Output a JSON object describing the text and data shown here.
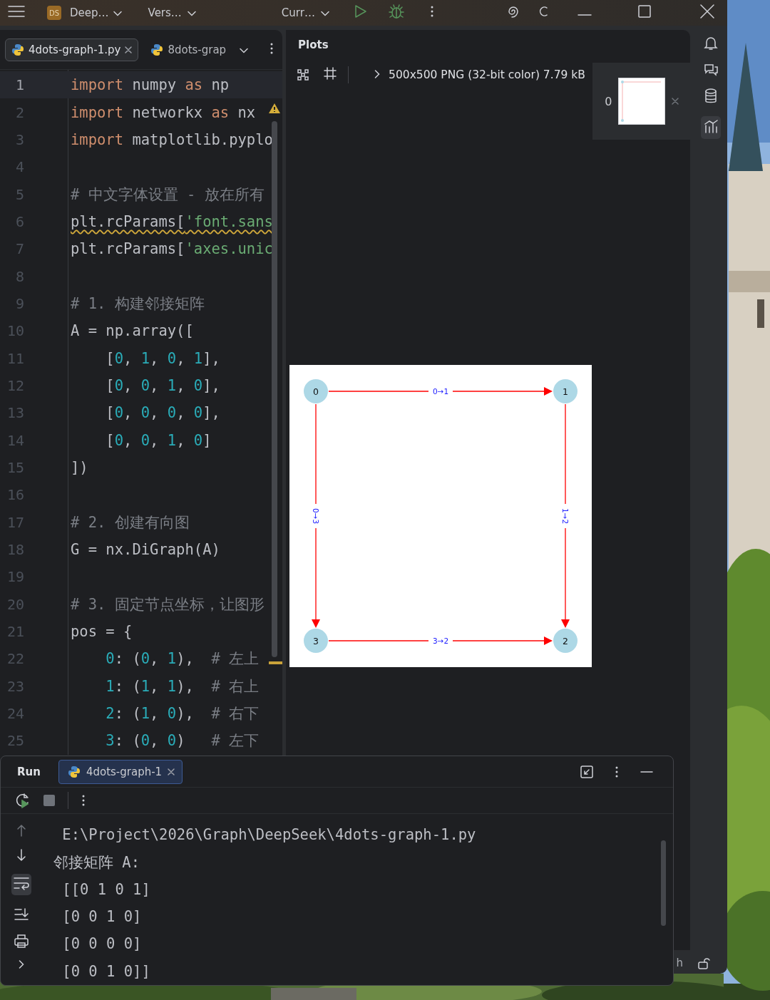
{
  "title_bar": {
    "project_badge": "DS",
    "project": "Deep…",
    "vcs": "Vers…",
    "run_config": "Curr…"
  },
  "editor": {
    "tabs": [
      {
        "label": "4dots-graph-1.py",
        "selected": true
      },
      {
        "label": "8dots-grap",
        "selected": false
      }
    ],
    "lines": [
      {
        "number": "1",
        "current": true,
        "tokens": [
          {
            "kind": "kw",
            "text": "import"
          },
          {
            "kind": "plain",
            "text": " numpy "
          },
          {
            "kind": "kw",
            "text": "as"
          },
          {
            "kind": "plain",
            "text": " np"
          }
        ]
      },
      {
        "number": "2",
        "current": false,
        "tokens": [
          {
            "kind": "kw",
            "text": "import"
          },
          {
            "kind": "plain",
            "text": " networkx "
          },
          {
            "kind": "kw",
            "text": "as"
          },
          {
            "kind": "plain",
            "text": " nx"
          }
        ]
      },
      {
        "number": "3",
        "current": false,
        "tokens": [
          {
            "kind": "kw",
            "text": "import"
          },
          {
            "kind": "plain",
            "text": " matplotlib.pyplo"
          }
        ]
      },
      {
        "number": "4",
        "current": false
      },
      {
        "number": "5",
        "current": false,
        "tokens": [
          {
            "kind": "comment",
            "text": "# 中文字体设置 - 放在所有"
          }
        ]
      },
      {
        "number": "6",
        "current": false,
        "warning": true,
        "tokens": [
          {
            "kind": "plain",
            "text": "plt.rcParams["
          },
          {
            "kind": "str",
            "text": "'font.sans"
          }
        ]
      },
      {
        "number": "7",
        "current": false,
        "tokens": [
          {
            "kind": "plain",
            "text": "plt.rcParams["
          },
          {
            "kind": "str",
            "text": "'axes.unic"
          }
        ]
      },
      {
        "number": "8",
        "current": false
      },
      {
        "number": "9",
        "current": false,
        "tokens": [
          {
            "kind": "comment",
            "text": "# 1. 构建邻接矩阵"
          }
        ]
      },
      {
        "number": "10",
        "current": false,
        "tokens": [
          {
            "kind": "plain",
            "text": "A = np.array(["
          }
        ]
      },
      {
        "number": "11",
        "current": false,
        "tokens": [
          {
            "kind": "plain",
            "text": "    ["
          },
          {
            "kind": "num",
            "text": "0"
          },
          {
            "kind": "plain",
            "text": ", "
          },
          {
            "kind": "num",
            "text": "1"
          },
          {
            "kind": "plain",
            "text": ", "
          },
          {
            "kind": "num",
            "text": "0"
          },
          {
            "kind": "plain",
            "text": ", "
          },
          {
            "kind": "num",
            "text": "1"
          },
          {
            "kind": "plain",
            "text": "],"
          }
        ]
      },
      {
        "number": "12",
        "current": false,
        "tokens": [
          {
            "kind": "plain",
            "text": "    ["
          },
          {
            "kind": "num",
            "text": "0"
          },
          {
            "kind": "plain",
            "text": ", "
          },
          {
            "kind": "num",
            "text": "0"
          },
          {
            "kind": "plain",
            "text": ", "
          },
          {
            "kind": "num",
            "text": "1"
          },
          {
            "kind": "plain",
            "text": ", "
          },
          {
            "kind": "num",
            "text": "0"
          },
          {
            "kind": "plain",
            "text": "],"
          }
        ]
      },
      {
        "number": "13",
        "current": false,
        "tokens": [
          {
            "kind": "plain",
            "text": "    ["
          },
          {
            "kind": "num",
            "text": "0"
          },
          {
            "kind": "plain",
            "text": ", "
          },
          {
            "kind": "num",
            "text": "0"
          },
          {
            "kind": "plain",
            "text": ", "
          },
          {
            "kind": "num",
            "text": "0"
          },
          {
            "kind": "plain",
            "text": ", "
          },
          {
            "kind": "num",
            "text": "0"
          },
          {
            "kind": "plain",
            "text": "],"
          }
        ]
      },
      {
        "number": "14",
        "current": false,
        "tokens": [
          {
            "kind": "plain",
            "text": "    ["
          },
          {
            "kind": "num",
            "text": "0"
          },
          {
            "kind": "plain",
            "text": ", "
          },
          {
            "kind": "num",
            "text": "0"
          },
          {
            "kind": "plain",
            "text": ", "
          },
          {
            "kind": "num",
            "text": "1"
          },
          {
            "kind": "plain",
            "text": ", "
          },
          {
            "kind": "num",
            "text": "0"
          },
          {
            "kind": "plain",
            "text": "]"
          }
        ]
      },
      {
        "number": "15",
        "current": false,
        "tokens": [
          {
            "kind": "plain",
            "text": "])"
          }
        ]
      },
      {
        "number": "16",
        "current": false
      },
      {
        "number": "17",
        "current": false,
        "tokens": [
          {
            "kind": "comment",
            "text": "# 2. 创建有向图"
          }
        ]
      },
      {
        "number": "18",
        "current": false,
        "tokens": [
          {
            "kind": "plain",
            "text": "G = nx.DiGraph(A)"
          }
        ]
      },
      {
        "number": "19",
        "current": false
      },
      {
        "number": "20",
        "current": false,
        "tokens": [
          {
            "kind": "comment",
            "text": "# 3. 固定节点坐标，让图形"
          }
        ]
      },
      {
        "number": "21",
        "current": false,
        "tokens": [
          {
            "kind": "plain",
            "text": "pos = {"
          }
        ]
      },
      {
        "number": "22",
        "current": false,
        "tokens": [
          {
            "kind": "num",
            "text": "    0"
          },
          {
            "kind": "plain",
            "text": ": ("
          },
          {
            "kind": "num",
            "text": "0"
          },
          {
            "kind": "plain",
            "text": ", "
          },
          {
            "kind": "num",
            "text": "1"
          },
          {
            "kind": "plain",
            "text": "),  "
          },
          {
            "kind": "comment",
            "text": "# 左上"
          }
        ]
      },
      {
        "number": "23",
        "current": false,
        "tokens": [
          {
            "kind": "num",
            "text": "    1"
          },
          {
            "kind": "plain",
            "text": ": ("
          },
          {
            "kind": "num",
            "text": "1"
          },
          {
            "kind": "plain",
            "text": ", "
          },
          {
            "kind": "num",
            "text": "1"
          },
          {
            "kind": "plain",
            "text": "),  "
          },
          {
            "kind": "comment",
            "text": "# 右上"
          }
        ]
      },
      {
        "number": "24",
        "current": false,
        "tokens": [
          {
            "kind": "num",
            "text": "    2"
          },
          {
            "kind": "plain",
            "text": ": ("
          },
          {
            "kind": "num",
            "text": "1"
          },
          {
            "kind": "plain",
            "text": ", "
          },
          {
            "kind": "num",
            "text": "0"
          },
          {
            "kind": "plain",
            "text": "),  "
          },
          {
            "kind": "comment",
            "text": "# 右下"
          }
        ]
      },
      {
        "number": "25",
        "current": false,
        "tokens": [
          {
            "kind": "num",
            "text": "    3"
          },
          {
            "kind": "plain",
            "text": ": ("
          },
          {
            "kind": "num",
            "text": "0"
          },
          {
            "kind": "plain",
            "text": ", "
          },
          {
            "kind": "num",
            "text": "0"
          },
          {
            "kind": "plain",
            "text": ")   "
          },
          {
            "kind": "comment",
            "text": "# 左下"
          }
        ]
      }
    ]
  },
  "plots": {
    "title": "Plots",
    "image_info": "500x500 PNG (32-bit color) 7.79 kB",
    "thumbnails": [
      {
        "label": "0",
        "selected": true
      }
    ],
    "graph": {
      "nodes": [
        {
          "label": "0"
        },
        {
          "label": "1"
        },
        {
          "label": "3"
        },
        {
          "label": "2"
        }
      ],
      "edges": [
        {
          "label": "0→1"
        },
        {
          "label": "0→3"
        },
        {
          "label": "1→2"
        },
        {
          "label": "3→2"
        }
      ]
    }
  },
  "run": {
    "title": "Run",
    "tabs": [
      {
        "label": "4dots-graph-1",
        "selected": true
      }
    ],
    "soft_wrap": true,
    "output": [
      " E:\\Project\\2026\\Graph\\DeepSeek\\4dots-graph-1.py",
      "邻接矩阵 A:",
      " [[0 1 0 1]",
      " [0 0 1 0]",
      " [0 0 0 0]",
      " [0 0 1 0]]"
    ]
  },
  "status_bar": {
    "text": "h"
  }
}
